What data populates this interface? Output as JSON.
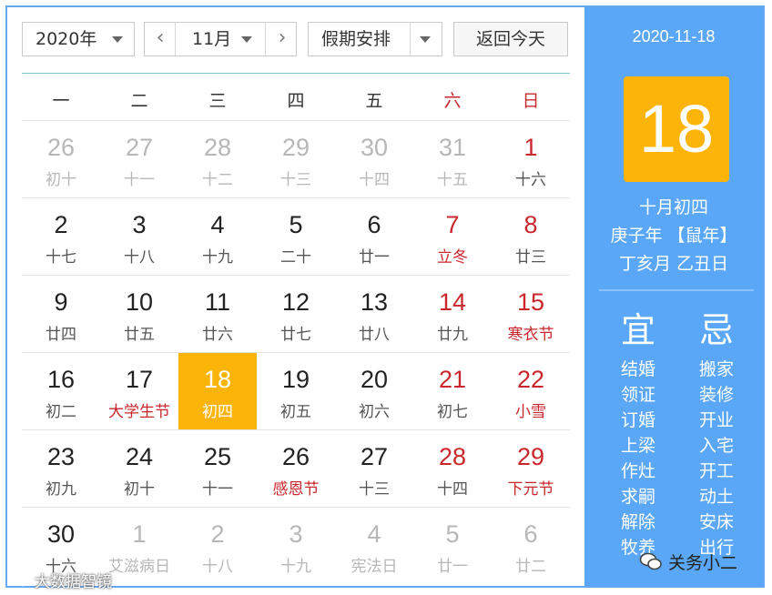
{
  "toolbar": {
    "year": "2020年",
    "month": "11月",
    "prev_glyph": "‹",
    "next_glyph": "›",
    "holiday": "假期安排",
    "today_button": "返回今天"
  },
  "weekdays": [
    "一",
    "二",
    "三",
    "四",
    "五",
    "六",
    "日"
  ],
  "weeks": [
    [
      {
        "day": "26",
        "lunar": "初十",
        "other": true
      },
      {
        "day": "27",
        "lunar": "十一",
        "other": true
      },
      {
        "day": "28",
        "lunar": "十二",
        "other": true
      },
      {
        "day": "29",
        "lunar": "十三",
        "other": true
      },
      {
        "day": "30",
        "lunar": "十四",
        "other": true
      },
      {
        "day": "31",
        "lunar": "十五",
        "other": true
      },
      {
        "day": "1",
        "lunar": "十六"
      }
    ],
    [
      {
        "day": "2",
        "lunar": "十七"
      },
      {
        "day": "3",
        "lunar": "十八"
      },
      {
        "day": "4",
        "lunar": "十九"
      },
      {
        "day": "5",
        "lunar": "二十"
      },
      {
        "day": "6",
        "lunar": "廿一"
      },
      {
        "day": "7",
        "lunar": "立冬",
        "festival": true
      },
      {
        "day": "8",
        "lunar": "廿三"
      }
    ],
    [
      {
        "day": "9",
        "lunar": "廿四"
      },
      {
        "day": "10",
        "lunar": "廿五"
      },
      {
        "day": "11",
        "lunar": "廿六"
      },
      {
        "day": "12",
        "lunar": "廿七"
      },
      {
        "day": "13",
        "lunar": "廿八"
      },
      {
        "day": "14",
        "lunar": "廿九"
      },
      {
        "day": "15",
        "lunar": "寒衣节",
        "festival": true
      }
    ],
    [
      {
        "day": "16",
        "lunar": "初二"
      },
      {
        "day": "17",
        "lunar": "大学生节",
        "festival": true
      },
      {
        "day": "18",
        "lunar": "初四",
        "today": true
      },
      {
        "day": "19",
        "lunar": "初五"
      },
      {
        "day": "20",
        "lunar": "初六"
      },
      {
        "day": "21",
        "lunar": "初七"
      },
      {
        "day": "22",
        "lunar": "小雪",
        "festival": true
      }
    ],
    [
      {
        "day": "23",
        "lunar": "初九"
      },
      {
        "day": "24",
        "lunar": "初十"
      },
      {
        "day": "25",
        "lunar": "十一"
      },
      {
        "day": "26",
        "lunar": "感恩节",
        "festival": true
      },
      {
        "day": "27",
        "lunar": "十三"
      },
      {
        "day": "28",
        "lunar": "十四"
      },
      {
        "day": "29",
        "lunar": "下元节",
        "festival": true
      }
    ],
    [
      {
        "day": "30",
        "lunar": "十六"
      },
      {
        "day": "1",
        "lunar": "艾滋病日",
        "other": true
      },
      {
        "day": "2",
        "lunar": "十八",
        "other": true
      },
      {
        "day": "3",
        "lunar": "十九",
        "other": true
      },
      {
        "day": "4",
        "lunar": "宪法日",
        "other": true
      },
      {
        "day": "5",
        "lunar": "廿一",
        "other": true
      },
      {
        "day": "6",
        "lunar": "廿二",
        "other": true
      }
    ]
  ],
  "side": {
    "date": "2020-11-18",
    "big_day": "18",
    "lunar_date": "十月初四",
    "year_gz": "庚子年 【鼠年】",
    "month_day_gz": "丁亥月 乙丑日",
    "yi_title": "宜",
    "ji_title": "忌",
    "yi": [
      "结婚",
      "领证",
      "订婚",
      "上梁",
      "作灶",
      "求嗣",
      "解除",
      "牧养"
    ],
    "ji": [
      "搬家",
      "装修",
      "开业",
      "入宅",
      "开工",
      "动土",
      "安床",
      "出行"
    ]
  },
  "watermark": {
    "left": "大数据智镜",
    "right": "关务小二"
  },
  "colors": {
    "accent_blue": "#5aa7f7",
    "today_orange": "#fcb409",
    "holiday_red": "#c9272c"
  }
}
